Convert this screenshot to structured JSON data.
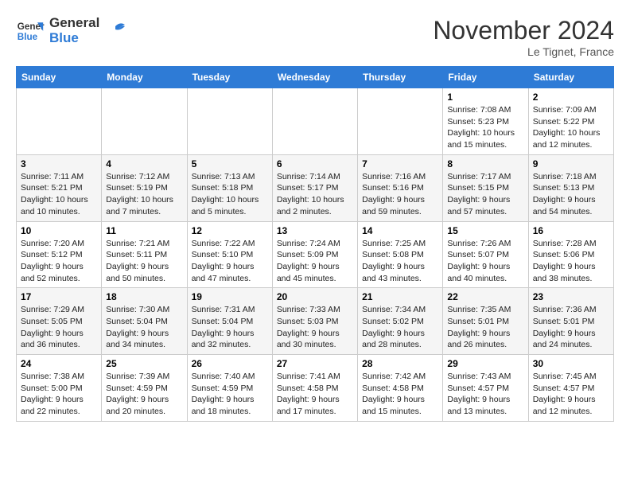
{
  "logo": {
    "text_general": "General",
    "text_blue": "Blue"
  },
  "header": {
    "month": "November 2024",
    "location": "Le Tignet, France"
  },
  "weekdays": [
    "Sunday",
    "Monday",
    "Tuesday",
    "Wednesday",
    "Thursday",
    "Friday",
    "Saturday"
  ],
  "weeks": [
    [
      {
        "day": "",
        "info": ""
      },
      {
        "day": "",
        "info": ""
      },
      {
        "day": "",
        "info": ""
      },
      {
        "day": "",
        "info": ""
      },
      {
        "day": "",
        "info": ""
      },
      {
        "day": "1",
        "info": "Sunrise: 7:08 AM\nSunset: 5:23 PM\nDaylight: 10 hours and 15 minutes."
      },
      {
        "day": "2",
        "info": "Sunrise: 7:09 AM\nSunset: 5:22 PM\nDaylight: 10 hours and 12 minutes."
      }
    ],
    [
      {
        "day": "3",
        "info": "Sunrise: 7:11 AM\nSunset: 5:21 PM\nDaylight: 10 hours and 10 minutes."
      },
      {
        "day": "4",
        "info": "Sunrise: 7:12 AM\nSunset: 5:19 PM\nDaylight: 10 hours and 7 minutes."
      },
      {
        "day": "5",
        "info": "Sunrise: 7:13 AM\nSunset: 5:18 PM\nDaylight: 10 hours and 5 minutes."
      },
      {
        "day": "6",
        "info": "Sunrise: 7:14 AM\nSunset: 5:17 PM\nDaylight: 10 hours and 2 minutes."
      },
      {
        "day": "7",
        "info": "Sunrise: 7:16 AM\nSunset: 5:16 PM\nDaylight: 9 hours and 59 minutes."
      },
      {
        "day": "8",
        "info": "Sunrise: 7:17 AM\nSunset: 5:15 PM\nDaylight: 9 hours and 57 minutes."
      },
      {
        "day": "9",
        "info": "Sunrise: 7:18 AM\nSunset: 5:13 PM\nDaylight: 9 hours and 54 minutes."
      }
    ],
    [
      {
        "day": "10",
        "info": "Sunrise: 7:20 AM\nSunset: 5:12 PM\nDaylight: 9 hours and 52 minutes."
      },
      {
        "day": "11",
        "info": "Sunrise: 7:21 AM\nSunset: 5:11 PM\nDaylight: 9 hours and 50 minutes."
      },
      {
        "day": "12",
        "info": "Sunrise: 7:22 AM\nSunset: 5:10 PM\nDaylight: 9 hours and 47 minutes."
      },
      {
        "day": "13",
        "info": "Sunrise: 7:24 AM\nSunset: 5:09 PM\nDaylight: 9 hours and 45 minutes."
      },
      {
        "day": "14",
        "info": "Sunrise: 7:25 AM\nSunset: 5:08 PM\nDaylight: 9 hours and 43 minutes."
      },
      {
        "day": "15",
        "info": "Sunrise: 7:26 AM\nSunset: 5:07 PM\nDaylight: 9 hours and 40 minutes."
      },
      {
        "day": "16",
        "info": "Sunrise: 7:28 AM\nSunset: 5:06 PM\nDaylight: 9 hours and 38 minutes."
      }
    ],
    [
      {
        "day": "17",
        "info": "Sunrise: 7:29 AM\nSunset: 5:05 PM\nDaylight: 9 hours and 36 minutes."
      },
      {
        "day": "18",
        "info": "Sunrise: 7:30 AM\nSunset: 5:04 PM\nDaylight: 9 hours and 34 minutes."
      },
      {
        "day": "19",
        "info": "Sunrise: 7:31 AM\nSunset: 5:04 PM\nDaylight: 9 hours and 32 minutes."
      },
      {
        "day": "20",
        "info": "Sunrise: 7:33 AM\nSunset: 5:03 PM\nDaylight: 9 hours and 30 minutes."
      },
      {
        "day": "21",
        "info": "Sunrise: 7:34 AM\nSunset: 5:02 PM\nDaylight: 9 hours and 28 minutes."
      },
      {
        "day": "22",
        "info": "Sunrise: 7:35 AM\nSunset: 5:01 PM\nDaylight: 9 hours and 26 minutes."
      },
      {
        "day": "23",
        "info": "Sunrise: 7:36 AM\nSunset: 5:01 PM\nDaylight: 9 hours and 24 minutes."
      }
    ],
    [
      {
        "day": "24",
        "info": "Sunrise: 7:38 AM\nSunset: 5:00 PM\nDaylight: 9 hours and 22 minutes."
      },
      {
        "day": "25",
        "info": "Sunrise: 7:39 AM\nSunset: 4:59 PM\nDaylight: 9 hours and 20 minutes."
      },
      {
        "day": "26",
        "info": "Sunrise: 7:40 AM\nSunset: 4:59 PM\nDaylight: 9 hours and 18 minutes."
      },
      {
        "day": "27",
        "info": "Sunrise: 7:41 AM\nSunset: 4:58 PM\nDaylight: 9 hours and 17 minutes."
      },
      {
        "day": "28",
        "info": "Sunrise: 7:42 AM\nSunset: 4:58 PM\nDaylight: 9 hours and 15 minutes."
      },
      {
        "day": "29",
        "info": "Sunrise: 7:43 AM\nSunset: 4:57 PM\nDaylight: 9 hours and 13 minutes."
      },
      {
        "day": "30",
        "info": "Sunrise: 7:45 AM\nSunset: 4:57 PM\nDaylight: 9 hours and 12 minutes."
      }
    ]
  ]
}
